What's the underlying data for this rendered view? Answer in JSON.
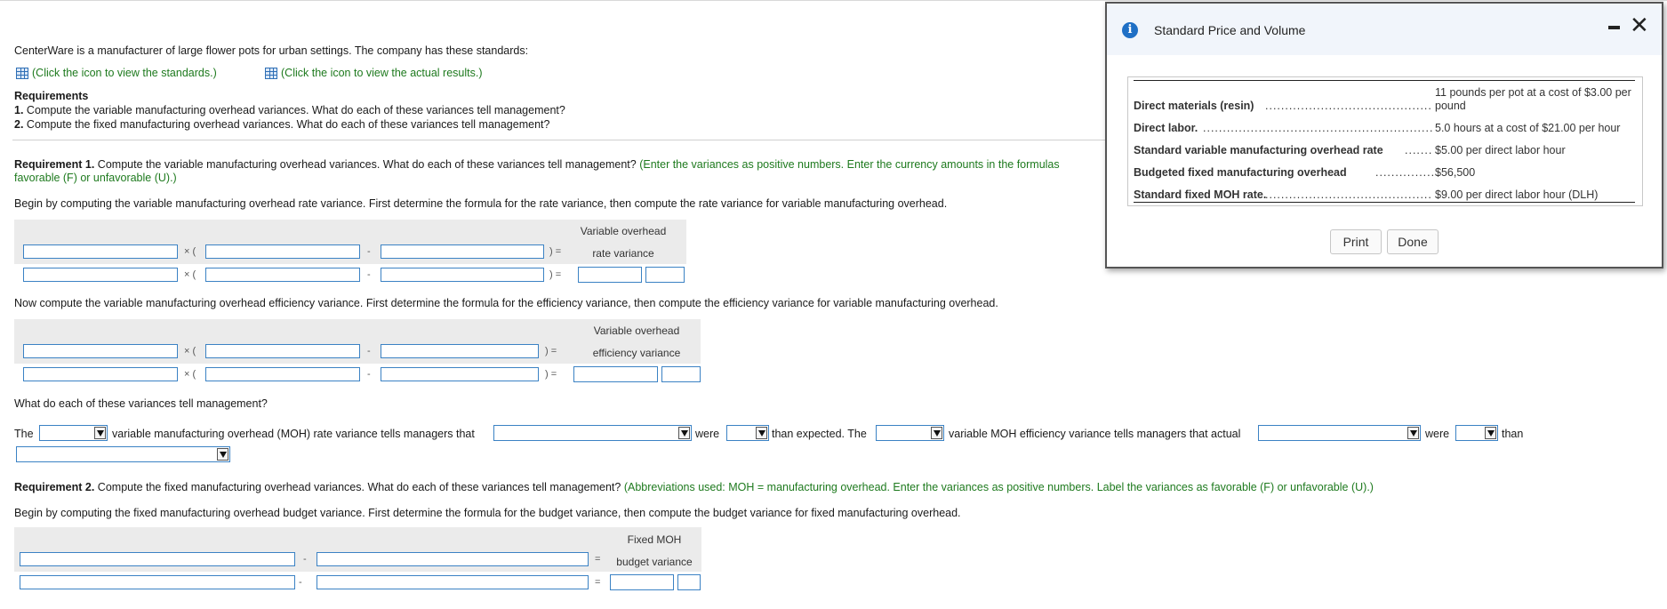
{
  "intro": "CenterWare is a manufacturer of large flower pots for urban settings. The company has these standards:",
  "links": {
    "standards": "(Click the icon to view the standards.)",
    "actual": "(Click the icon to view the actual results.)"
  },
  "requirements": {
    "heading": "Requirements",
    "r1_num": "1.",
    "r1": "Compute the variable manufacturing overhead variances. What do each of these variances tell management?",
    "r2_num": "2.",
    "r2": "Compute the fixed manufacturing overhead variances. What do each of these variances tell management?"
  },
  "req1": {
    "label": "Requirement 1.",
    "text": "Compute the variable manufacturing overhead variances. What do each of these variances tell management?",
    "instr_a": "(Enter the variances as positive numbers. Enter the currency amounts in the formulas",
    "instr_b": "favorable (F) or unfavorable (U).)",
    "rate_intro": "Begin by computing the variable manufacturing overhead rate variance. First determine the formula for the rate variance, then compute the rate variance for variable manufacturing overhead.",
    "rate_head1": "Variable overhead",
    "rate_head2": "rate variance",
    "eff_intro": "Now compute the variable manufacturing overhead efficiency variance. First determine the formula for the efficiency variance, then compute the efficiency variance for variable manufacturing overhead.",
    "eff_head1": "Variable overhead",
    "eff_head2": "efficiency variance",
    "question": "What do each of these variances tell management?"
  },
  "ops": {
    "times": "× (",
    "minus": "-",
    "close_eq": ")  =",
    "eq": "="
  },
  "sentence": {
    "the": "The",
    "part1": "variable manufacturing overhead (MOH) rate variance tells managers that",
    "were": "were",
    "than_expected": "than expected. The",
    "part2": "variable MOH efficiency variance tells managers that actual",
    "were2": "were",
    "than": "than"
  },
  "req2": {
    "label": "Requirement 2.",
    "text": "Compute the fixed manufacturing overhead variances. What do each of these variances tell management?",
    "instr": "(Abbreviations used: MOH = manufacturing overhead. Enter the variances as positive numbers. Label the variances as favorable (F) or unfavorable (U).)",
    "budget_intro": "Begin by computing the fixed manufacturing overhead budget variance. First determine the formula for the budget variance, then compute the budget variance for fixed manufacturing overhead.",
    "budget_head1": "Fixed MOH",
    "budget_head2": "budget variance"
  },
  "modal": {
    "title": "Standard Price and Volume",
    "icon": "info-icon",
    "rows": [
      {
        "label": "Direct materials (resin)",
        "value_line1": "11 pounds per pot at a cost of $3.00 per",
        "value_line2": "pound"
      },
      {
        "label": "Direct labor.",
        "value": "5.0 hours at a cost of $21.00 per hour"
      },
      {
        "label": "Standard variable manufacturing overhead rate",
        "value": "$5.00 per direct labor hour"
      },
      {
        "label": "Budgeted fixed manufacturing overhead",
        "value": "$56,500"
      },
      {
        "label": "Standard fixed MOH rate.",
        "value": "$9.00 per direct labor hour (DLH)"
      }
    ],
    "print_label": "Print",
    "done_label": "Done"
  }
}
